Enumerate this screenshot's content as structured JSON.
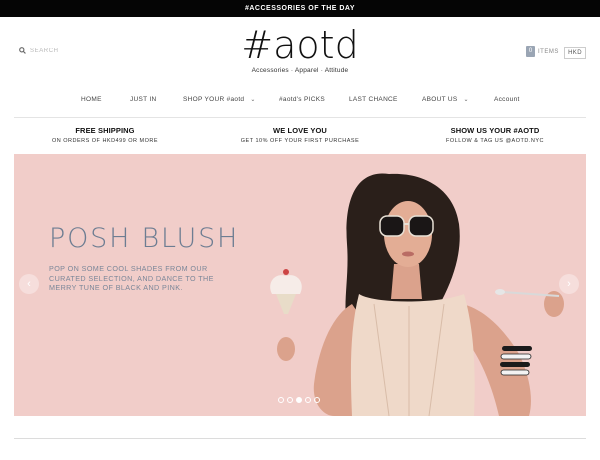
{
  "topbar": {
    "text": "#ACCESSORIES OF THE DAY"
  },
  "search": {
    "placeholder": "SEARCH",
    "icon": "search-icon"
  },
  "logo": {
    "main": "#aotd",
    "tagline": "Accessories · Apparel · Attitude"
  },
  "cart": {
    "count": "0",
    "label": "ITEMS",
    "currency": "HKD"
  },
  "nav": {
    "items": [
      {
        "label": "HOME"
      },
      {
        "label": "JUST IN"
      },
      {
        "label": "SHOP YOUR #aotd",
        "dropdown": true
      },
      {
        "label": "#aotd's PICKS"
      },
      {
        "label": "LAST CHANCE"
      },
      {
        "label": "ABOUT US",
        "dropdown": true
      },
      {
        "label": "Account"
      }
    ]
  },
  "promos": [
    {
      "title": "FREE SHIPPING",
      "subtitle": "ON ORDERS OF HKD499 OR MORE"
    },
    {
      "title": "WE LOVE YOU",
      "subtitle": "GET 10% OFF YOUR FIRST PURCHASE"
    },
    {
      "title": "SHOW US YOUR #AOTD",
      "subtitle": "FOLLOW & TAG US @AOTD.NYC"
    }
  ],
  "hero": {
    "title": "POSH BLUSH",
    "body": "POP ON SOME COOL SHADES FROM OUR CURATED SELECTION, AND DANCE TO THE MERRY TUNE OF BLACK AND PINK.",
    "background_color": "#f1cdc9",
    "title_color": "#6d7d92",
    "slides": 5,
    "active_slide": 3
  }
}
